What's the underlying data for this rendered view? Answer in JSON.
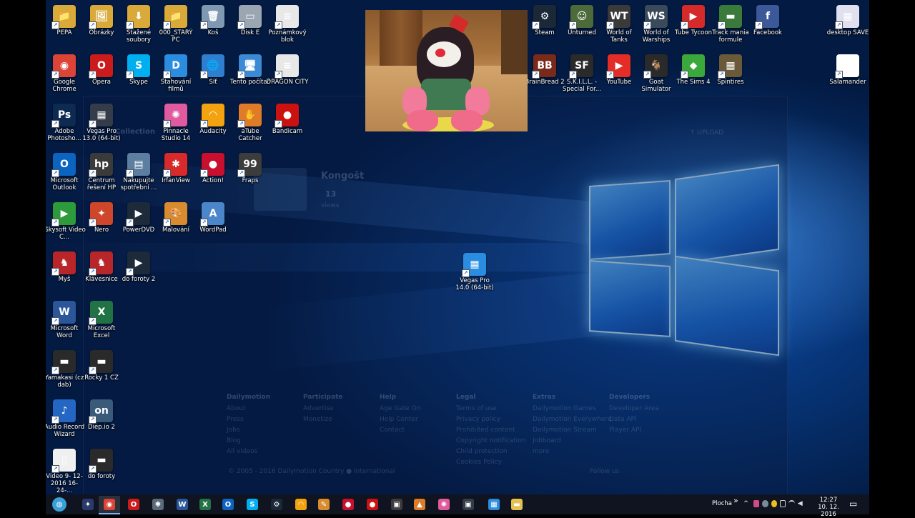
{
  "desktop_icons": [
    {
      "label": "PEPA",
      "glyph": "📁",
      "color": "#d9a93a",
      "col": 0,
      "row": 0
    },
    {
      "label": "Obrázky",
      "glyph": "🖼",
      "color": "#d9a93a",
      "col": 1,
      "row": 0
    },
    {
      "label": "Stažené soubory",
      "glyph": "⬇",
      "color": "#d9a93a",
      "col": 2,
      "row": 0
    },
    {
      "label": "000_STARÝ PC",
      "glyph": "📁",
      "color": "#d9a93a",
      "col": 3,
      "row": 0
    },
    {
      "label": "Koš",
      "glyph": "🗑",
      "color": "#7f99b3",
      "col": 4,
      "row": 0
    },
    {
      "label": "Disk E",
      "glyph": "▭",
      "color": "#9aa6b2",
      "col": 5,
      "row": 0
    },
    {
      "label": "Poznámkový blok",
      "glyph": "≡",
      "color": "#e8e8e8",
      "col": 6,
      "row": 0
    },
    {
      "label": "Google Chrome",
      "glyph": "◉",
      "color": "#db4437",
      "col": 0,
      "row": 1
    },
    {
      "label": "Opera",
      "glyph": "O",
      "color": "#cc1b1b",
      "col": 1,
      "row": 1
    },
    {
      "label": "Skype",
      "glyph": "S",
      "color": "#00aff0",
      "col": 2,
      "row": 1
    },
    {
      "label": "Stahování filmů",
      "glyph": "D",
      "color": "#2a8de0",
      "col": 3,
      "row": 1
    },
    {
      "label": "Síť",
      "glyph": "🌐",
      "color": "#2f7fd1",
      "col": 4,
      "row": 1
    },
    {
      "label": "Tento počítač",
      "glyph": "🖥",
      "color": "#3a8ad6",
      "col": 5,
      "row": 1
    },
    {
      "label": "DRAGON CITY",
      "glyph": "≡",
      "color": "#e8e8e8",
      "col": 6,
      "row": 1
    },
    {
      "label": "Adobe Photosho...",
      "glyph": "Ps",
      "color": "#0d2a52",
      "col": 0,
      "row": 2
    },
    {
      "label": "Vegas Pro 13.0 (64-bit)",
      "glyph": "▦",
      "color": "#333c48",
      "col": 1,
      "row": 2
    },
    {
      "label": "Pinnacle Studio 14",
      "glyph": "✺",
      "color": "#e05aa0",
      "col": 3,
      "row": 2
    },
    {
      "label": "Audacity",
      "glyph": "◠",
      "color": "#f2a30f",
      "col": 4,
      "row": 2
    },
    {
      "label": "aTube Catcher",
      "glyph": "✋",
      "color": "#e07b2a",
      "col": 5,
      "row": 2
    },
    {
      "label": "Bandicam",
      "glyph": "●",
      "color": "#cc1111",
      "col": 6,
      "row": 2
    },
    {
      "label": "Microsoft Outlook",
      "glyph": "O",
      "color": "#0a64c0",
      "col": 0,
      "row": 3
    },
    {
      "label": "Centrum řešení HP",
      "glyph": "hp",
      "color": "#3a3a3a",
      "col": 1,
      "row": 3
    },
    {
      "label": "Nakupujte spotřební ...",
      "glyph": "▤",
      "color": "#5c7ea0",
      "col": 2,
      "row": 3
    },
    {
      "label": "IrfanView",
      "glyph": "✱",
      "color": "#d82a2a",
      "col": 3,
      "row": 3
    },
    {
      "label": "Action!",
      "glyph": "●",
      "color": "#c8102e",
      "col": 4,
      "row": 3
    },
    {
      "label": "Fraps",
      "glyph": "99",
      "color": "#3c3c3c",
      "col": 5,
      "row": 3
    },
    {
      "label": "iSkysoft Video C...",
      "glyph": "▶",
      "color": "#2d9b3b",
      "col": 0,
      "row": 4
    },
    {
      "label": "Nero",
      "glyph": "✦",
      "color": "#d0462a",
      "col": 1,
      "row": 4
    },
    {
      "label": "PowerDVD",
      "glyph": "▶",
      "color": "#1c2a3a",
      "col": 2,
      "row": 4
    },
    {
      "label": "Malování",
      "glyph": "🎨",
      "color": "#d98c2f",
      "col": 3,
      "row": 4
    },
    {
      "label": "WordPad",
      "glyph": "A",
      "color": "#4a86c9",
      "col": 4,
      "row": 4
    },
    {
      "label": "Myš",
      "glyph": "♞",
      "color": "#b8262a",
      "col": 0,
      "row": 5
    },
    {
      "label": "Klávesnice",
      "glyph": "♞",
      "color": "#b8262a",
      "col": 1,
      "row": 5
    },
    {
      "label": "do foroty 2",
      "glyph": "▶",
      "color": "#1c2a3a",
      "col": 2,
      "row": 5
    },
    {
      "label": "Microsoft Word",
      "glyph": "W",
      "color": "#2b579a",
      "col": 0,
      "row": 6
    },
    {
      "label": "Microsoft Excel",
      "glyph": "X",
      "color": "#217346",
      "col": 1,
      "row": 6
    },
    {
      "label": "Yamakasi (cz dab)",
      "glyph": "▬",
      "color": "#2a2a2a",
      "col": 0,
      "row": 7
    },
    {
      "label": "Rocky 1  CZ",
      "glyph": "▬",
      "color": "#2a2a2a",
      "col": 1,
      "row": 7
    },
    {
      "label": "Audio Record Wizard",
      "glyph": "♪",
      "color": "#2466c4",
      "col": 0,
      "row": 8
    },
    {
      "label": "Diep.io 2",
      "glyph": "on",
      "color": "#3a5a7a",
      "col": 1,
      "row": 8
    },
    {
      "label": "Video 9- 12-2016 16-24-...",
      "glyph": "▯",
      "color": "#f0f0f0",
      "col": 0,
      "row": 9
    },
    {
      "label": "do foroty",
      "glyph": "▬",
      "color": "#2a2a2a",
      "col": 1,
      "row": 9
    },
    {
      "label": "Steam",
      "glyph": "⚙",
      "color": "#1b2838",
      "col": 10,
      "row": 0
    },
    {
      "label": "Unturned",
      "glyph": "☺",
      "color": "#4d6b3a",
      "col": 11,
      "row": 0
    },
    {
      "label": "World of Tanks",
      "glyph": "WT",
      "color": "#3a3a3a",
      "col": 12,
      "row": 0
    },
    {
      "label": "World of Warships",
      "glyph": "WS",
      "color": "#3a4a5a",
      "col": 13,
      "row": 0
    },
    {
      "label": "Tube Tycoon",
      "glyph": "▶",
      "color": "#d42a2a",
      "col": 14,
      "row": 0
    },
    {
      "label": "Track mania formule",
      "glyph": "▬",
      "color": "#3a7a3a",
      "col": 15,
      "row": 0
    },
    {
      "label": "Facebook",
      "glyph": "f",
      "color": "#3b5998",
      "col": 16,
      "row": 0
    },
    {
      "label": "desktop SAVE",
      "glyph": "▦",
      "color": "#e0e0f0",
      "col": 18,
      "row": 0
    },
    {
      "label": "BrainBread 2",
      "glyph": "BB",
      "color": "#7a2a1a",
      "col": 10,
      "row": 1
    },
    {
      "label": "S.K.I.L.L. - Special For...",
      "glyph": "SF",
      "color": "#2a2a2a",
      "col": 11,
      "row": 1
    },
    {
      "label": "YouTube",
      "glyph": "▶",
      "color": "#e52d27",
      "col": 12,
      "row": 1
    },
    {
      "label": "Goat Simulator",
      "glyph": "🐐",
      "color": "#2a2a2a",
      "col": 13,
      "row": 1
    },
    {
      "label": "The Sims 4",
      "glyph": "◆",
      "color": "#3aa83a",
      "col": 14,
      "row": 1
    },
    {
      "label": "Spintires",
      "glyph": "▦",
      "color": "#6a5a3a",
      "col": 15,
      "row": 1
    },
    {
      "label": "Salamander",
      "glyph": "✦",
      "color": "#ffffff",
      "col": 18,
      "row": 1
    }
  ],
  "floating_icon": {
    "label": "Vegas Pro 14.0 (64-bit)",
    "glyph": "▦",
    "color": "#2a8de0"
  },
  "ghost_page": {
    "title": "Kongošt",
    "views_count": "13",
    "views_label": "views",
    "nav_text": "Collection",
    "upload": "↑ UPLOAD",
    "columns": [
      {
        "heading": "Dailymotion",
        "links": [
          "About",
          "Press",
          "Jobs",
          "Blog",
          "All videos"
        ]
      },
      {
        "heading": "Participate",
        "links": [
          "Advertise",
          "Monetize"
        ]
      },
      {
        "heading": "Help",
        "links": [
          "Age Gate On",
          "Help Center",
          "Contact"
        ]
      },
      {
        "heading": "Legal",
        "links": [
          "Terms of use",
          "Privacy policy",
          "Prohibited content",
          "Copyright notification",
          "Child protection",
          "Cookies Policy"
        ]
      },
      {
        "heading": "Extras",
        "links": [
          "Dailymotion Games",
          "Dailymotion Everywhere",
          "Dailymotion Stream",
          "Jobboard",
          "more"
        ]
      },
      {
        "heading": "Developers",
        "links": [
          "Developer Area",
          "Data API",
          "Player API"
        ]
      }
    ],
    "copyright": "© 2005 - 2016 Dailymotion  Country  ● International",
    "follow": "Follow us"
  },
  "taskbar": {
    "apps": [
      {
        "name": "start",
        "glyph": "◍",
        "color": "#3aa0d8"
      },
      {
        "name": "bat",
        "glyph": "✦",
        "color": "#2a3a6a"
      },
      {
        "name": "chrome",
        "glyph": "◉",
        "color": "#db4437",
        "active": true
      },
      {
        "name": "opera",
        "glyph": "O",
        "color": "#cc1b1b"
      },
      {
        "name": "tool",
        "glyph": "✱",
        "color": "#5a6a7a"
      },
      {
        "name": "word",
        "glyph": "W",
        "color": "#2b579a"
      },
      {
        "name": "excel",
        "glyph": "X",
        "color": "#217346"
      },
      {
        "name": "outlook",
        "glyph": "O",
        "color": "#0a64c0"
      },
      {
        "name": "skype",
        "glyph": "S",
        "color": "#00aff0"
      },
      {
        "name": "steam",
        "glyph": "⚙",
        "color": "#1b2838"
      },
      {
        "name": "audacity",
        "glyph": "◠",
        "color": "#f2a30f"
      },
      {
        "name": "paint",
        "glyph": "✎",
        "color": "#d98c2f"
      },
      {
        "name": "action",
        "glyph": "●",
        "color": "#c8102e"
      },
      {
        "name": "bandicam",
        "glyph": "●",
        "color": "#cc1111"
      },
      {
        "name": "fraps",
        "glyph": "▣",
        "color": "#3c3c3c"
      },
      {
        "name": "fire",
        "glyph": "▲",
        "color": "#e07b2a"
      },
      {
        "name": "pinnacle",
        "glyph": "✺",
        "color": "#e05aa0"
      },
      {
        "name": "film",
        "glyph": "▣",
        "color": "#333c48"
      },
      {
        "name": "vegas",
        "glyph": "▦",
        "color": "#2a8de0"
      },
      {
        "name": "explorer",
        "glyph": "▬",
        "color": "#e8c050"
      }
    ],
    "desktop_label": "Plocha",
    "chevron": "»",
    "tray_up": "^",
    "time": "12:27",
    "date": "10. 12. 2016",
    "notif": "▭"
  }
}
